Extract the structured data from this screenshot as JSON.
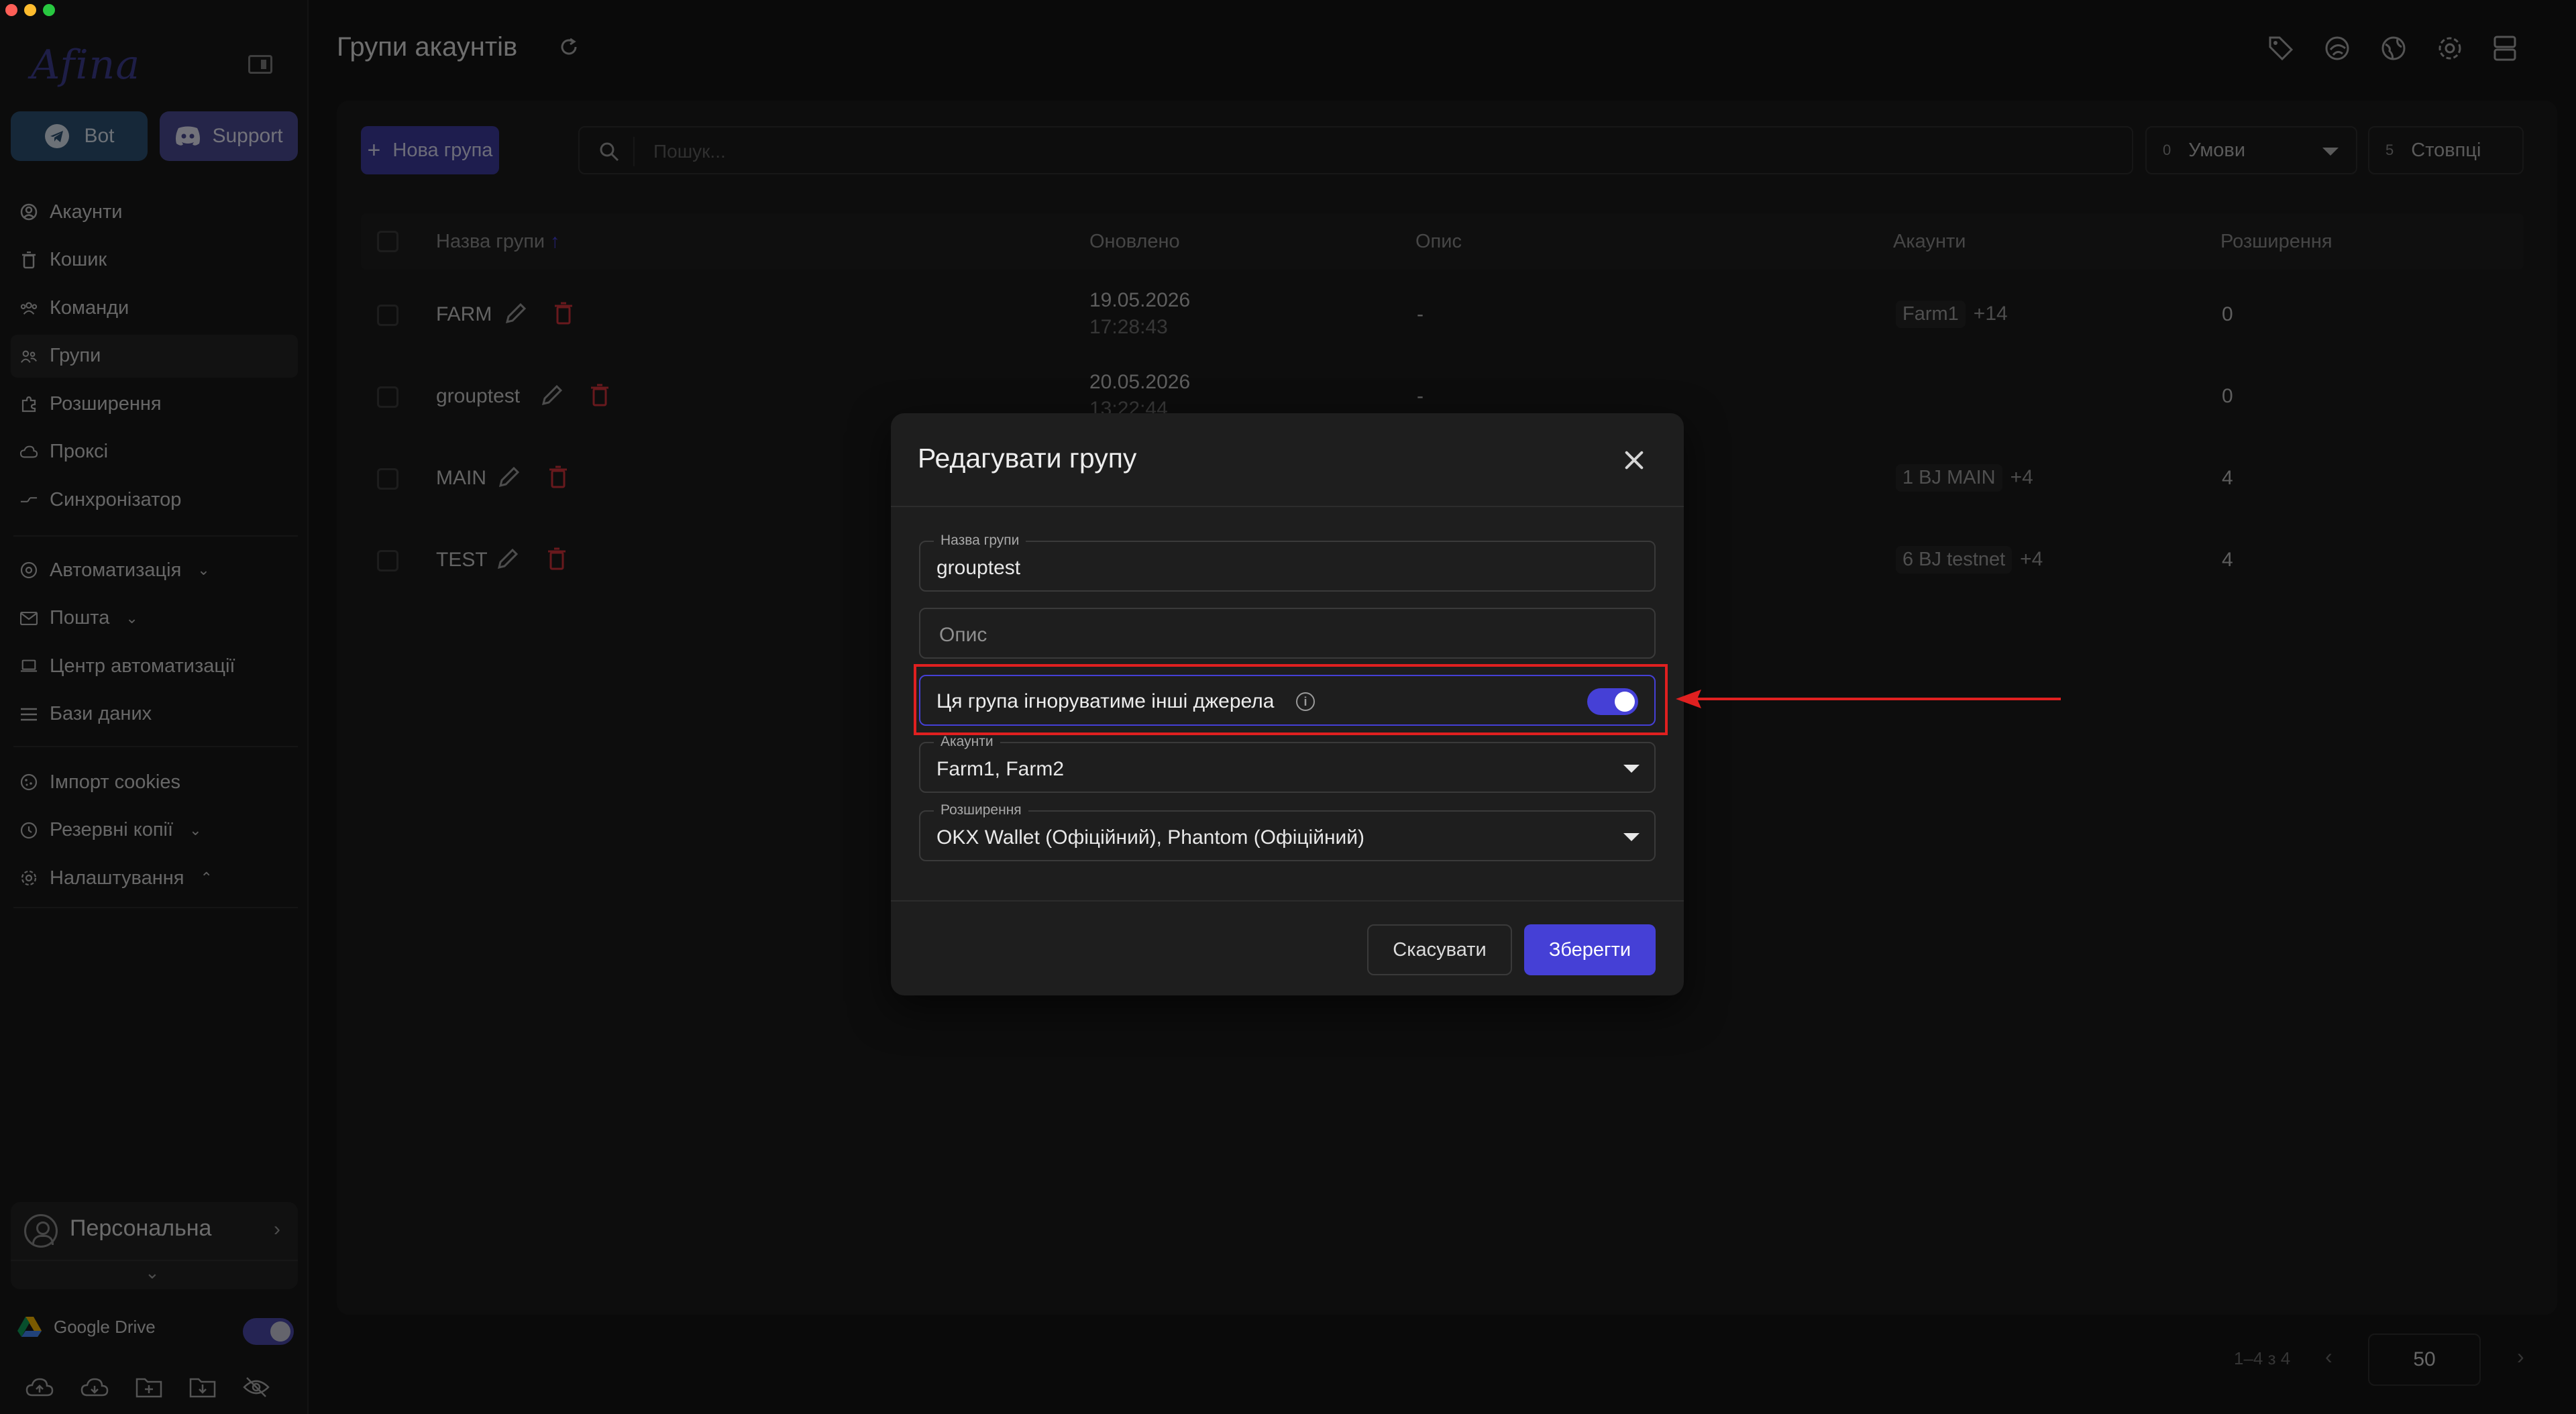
{
  "app": {
    "logo_text": "Afina",
    "page_title": "Групи акаунтів"
  },
  "sidebar": {
    "bot_label": "Bot",
    "support_label": "Support",
    "nav_group1": [
      {
        "label": "Акаунти",
        "icon": "user-circle-icon"
      },
      {
        "label": "Кошик",
        "icon": "trash-icon"
      },
      {
        "label": "Команди",
        "icon": "team-icon"
      },
      {
        "label": "Групи",
        "icon": "group-icon",
        "active": true
      },
      {
        "label": "Розширення",
        "icon": "puzzle-icon"
      },
      {
        "label": "Проксі",
        "icon": "cloud-icon"
      },
      {
        "label": "Синхронізатор",
        "icon": "sync-icon"
      }
    ],
    "nav_group2": [
      {
        "label": "Автоматизація",
        "icon": "automation-icon",
        "chevron": "down"
      },
      {
        "label": "Пошта",
        "icon": "mail-icon",
        "chevron": "down"
      },
      {
        "label": "Центр автоматизації",
        "icon": "laptop-icon"
      },
      {
        "label": "Бази даних",
        "icon": "list-icon"
      }
    ],
    "nav_group3": [
      {
        "label": "Імпорт cookies",
        "icon": "cookie-icon"
      },
      {
        "label": "Резервні копії",
        "icon": "backup-icon",
        "chevron": "down"
      },
      {
        "label": "Налаштування",
        "icon": "settings-icon",
        "chevron": "up"
      }
    ],
    "workspace_label": "Персональна",
    "gdrive_label": "Google Drive",
    "gdrive_enabled": true
  },
  "toolbar": {
    "new_group_label": "Нова група",
    "search_placeholder": "Пошук...",
    "conditions_count": "0",
    "conditions_label": "Умови",
    "columns_count": "5",
    "columns_label": "Стовпці"
  },
  "table": {
    "headers": {
      "name": "Назва групи",
      "updated": "Оновлено",
      "description": "Опис",
      "accounts": "Акаунти",
      "extensions": "Розширення"
    },
    "rows": [
      {
        "name": "FARM",
        "date": "19.05.2026",
        "time": "17:28:43",
        "description": "-",
        "account_chip": "Farm1",
        "account_more": "+14",
        "extensions": "0"
      },
      {
        "name": "grouptest",
        "date": "20.05.2026",
        "time": "13:22:44",
        "description": "-",
        "account_chip": "",
        "account_more": "",
        "extensions": "0"
      },
      {
        "name": "MAIN",
        "date": "",
        "time": "",
        "description": "",
        "account_chip": "1 BJ MAIN",
        "account_more": "+4",
        "extensions": "4"
      },
      {
        "name": "TEST",
        "date": "",
        "time": "",
        "description": "",
        "account_chip": "6 BJ testnet",
        "account_more": "+4",
        "extensions": "4"
      }
    ]
  },
  "pagination": {
    "range": "1–4 з 4",
    "per_page": "50"
  },
  "modal": {
    "title": "Редагувати групу",
    "name_label": "Назва групи",
    "name_value": "grouptest",
    "description_placeholder": "Опис",
    "ignore_sources_label": "Ця група ігноруватиме інші джерела",
    "ignore_sources_enabled": true,
    "accounts_label": "Акаунти",
    "accounts_value": "Farm1, Farm2",
    "extensions_label": "Розширення",
    "extensions_value": "OKX Wallet (Офіційний), Phantom (Офіційний)",
    "cancel_label": "Скасувати",
    "save_label": "Зберегти"
  },
  "colors": {
    "accent": "#4540d6",
    "highlight": "#e02020",
    "delete": "#d0323a"
  }
}
